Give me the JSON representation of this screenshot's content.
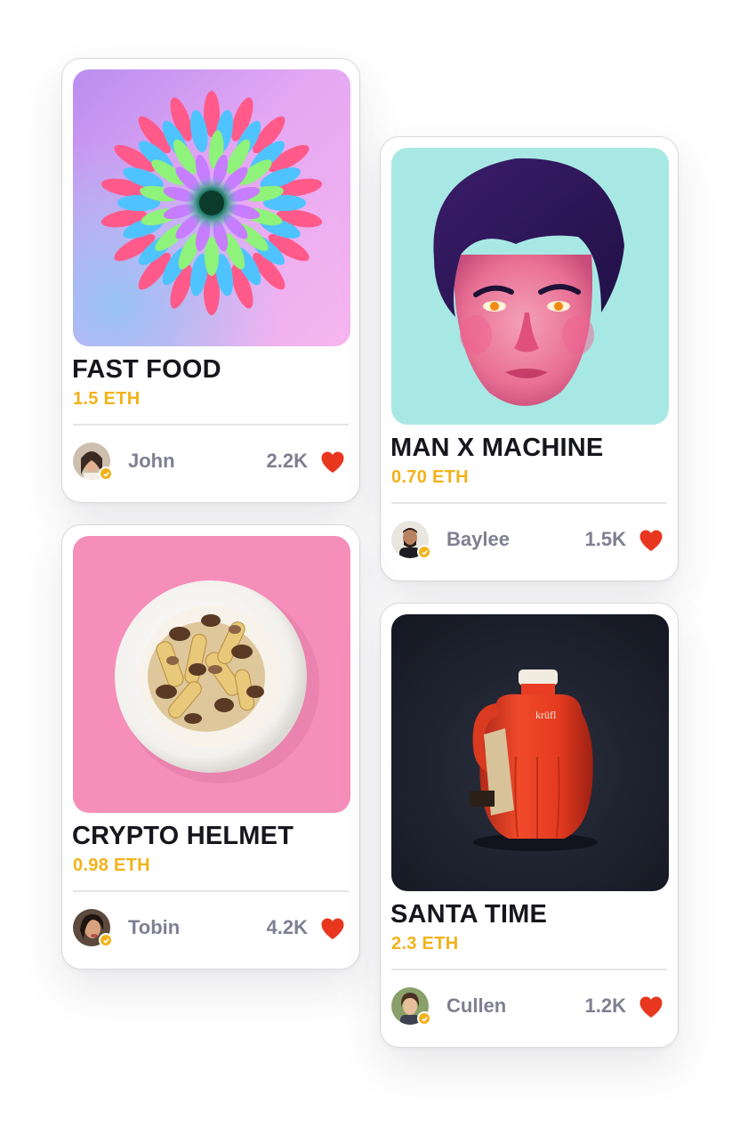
{
  "cards": [
    {
      "title": "FAST FOOD",
      "price": "1.5 ETH",
      "owner": "John",
      "likes": "2.2K",
      "art": "flower-artwork"
    },
    {
      "title": "MAN X MACHINE",
      "price": "0.70 ETH",
      "owner": "Baylee",
      "likes": "1.5K",
      "art": "portrait-artwork"
    },
    {
      "title": "CRYPTO HELMET",
      "price": "0.98 ETH",
      "owner": "Tobin",
      "likes": "4.2K",
      "art": "food-plate-artwork"
    },
    {
      "title": "SANTA TIME",
      "price": "2.3 ETH",
      "owner": "Cullen",
      "likes": "1.2K",
      "art": "red-bottle-artwork"
    }
  ],
  "colors": {
    "price": "#f2b21a",
    "heart": "#e8361f",
    "muted_text": "#7f7f92",
    "title_text": "#16161d",
    "verified_badge": "#f2b21a"
  },
  "icons": {
    "like": "heart-icon",
    "verified": "verified-badge-icon"
  }
}
